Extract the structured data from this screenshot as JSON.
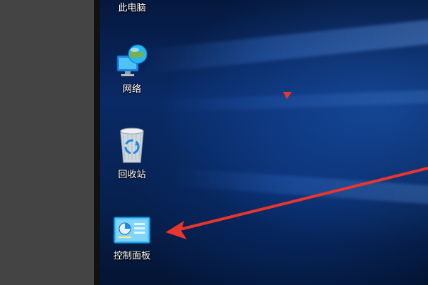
{
  "desktop": {
    "icons": [
      {
        "label": "此电脑",
        "icon": "this-pc-icon"
      },
      {
        "label": "网络",
        "icon": "network-icon"
      },
      {
        "label": "回收站",
        "icon": "recycle-bin-icon"
      },
      {
        "label": "控制面板",
        "icon": "control-panel-icon"
      }
    ]
  },
  "colors": {
    "left_pane": "#444444",
    "desktop_base": "#0a2a66",
    "annotation_arrow": "#e8352e"
  }
}
